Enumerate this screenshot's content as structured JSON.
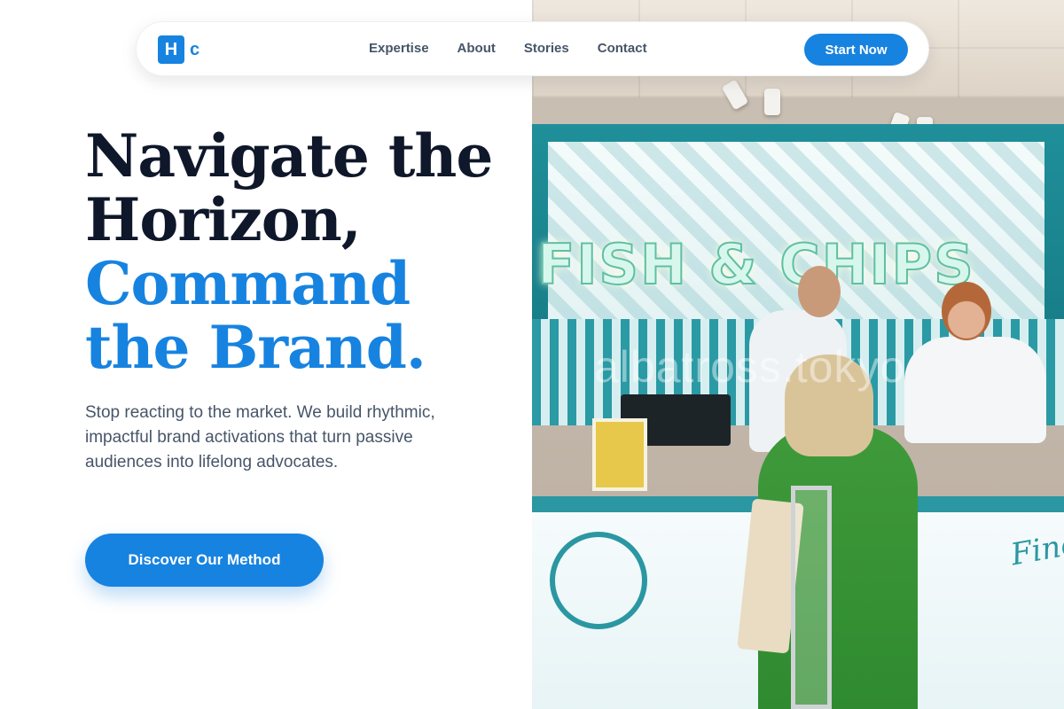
{
  "brand": {
    "logo_letter": "H",
    "logo_suffix": "c"
  },
  "nav": {
    "links": [
      "Expertise",
      "About",
      "Stories",
      "Contact"
    ],
    "cta_label": "Start Now"
  },
  "hero": {
    "title_line1": "Navigate the",
    "title_line2": "Horizon,",
    "title_line3": "Command",
    "title_line4": "the Brand.",
    "subtitle": "Stop reacting to the market. We build rhythmic, impactful brand activations that turn passive audiences into lifelong advocates.",
    "cta_label": "Discover Our Method"
  },
  "photo": {
    "sign_text": "FISH & CHIPS",
    "counter_script": "Fine",
    "watermark": "albatross.tokyo"
  },
  "colors": {
    "accent": "#1783e0",
    "heading": "#0f172a",
    "body": "#475569",
    "kiosk_teal": "#2a97a2"
  }
}
